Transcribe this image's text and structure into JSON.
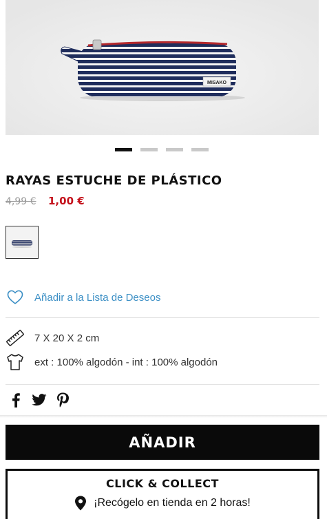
{
  "product": {
    "title": "RAYAS ESTUCHE DE PLÁSTICO",
    "price_old": "4,99 €",
    "price_new": "1,00 €",
    "brand_tag": "MISAKO",
    "carousel": {
      "slides": 4,
      "active": 1
    }
  },
  "wishlist": {
    "label": "Añadir a la Lista de Deseos"
  },
  "specs": [
    {
      "icon": "ruler-icon",
      "text": "7 X 20 X 2 cm"
    },
    {
      "icon": "tshirt-icon",
      "text": "ext : 100% algodón - int : 100% algodón"
    }
  ],
  "social": [
    "facebook-icon",
    "twitter-icon",
    "pinterest-icon"
  ],
  "actions": {
    "add_label": "AÑADIR",
    "click_collect_title": "CLICK & COLLECT",
    "click_collect_text": "¡Recógelo en tienda en 2 horas!"
  },
  "colors": {
    "price_sale": "#c4111b",
    "link": "#3b8fc5",
    "button_bg": "#0a0a0a"
  }
}
